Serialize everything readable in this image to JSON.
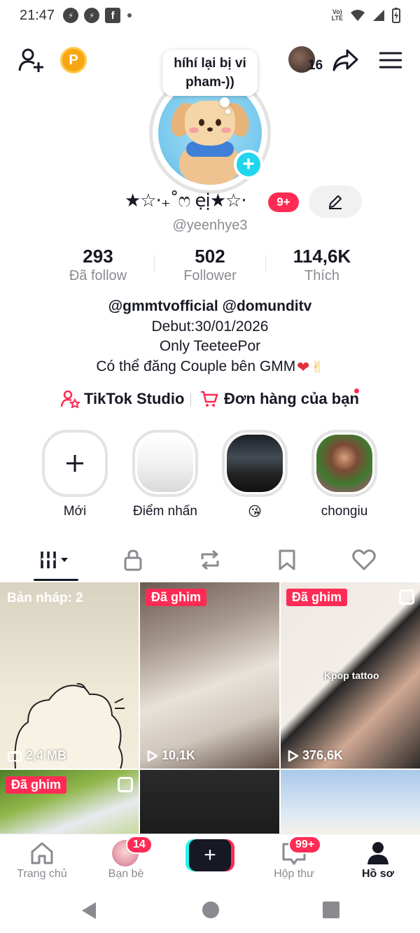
{
  "status_bar": {
    "time": "21:47",
    "volte": "VoLTE"
  },
  "bubble": {
    "line1": "híhí lại bị vi",
    "line2": "pham-))"
  },
  "top_bar": {
    "following_count": "16",
    "coin_letter": "P"
  },
  "profile": {
    "display_name": "★☆·₊˚ෆ ẹị★☆·",
    "name_badge": "9+",
    "username": "@yeenhye3"
  },
  "stats": [
    {
      "value": "293",
      "label": "Đã follow"
    },
    {
      "value": "502",
      "label": "Follower"
    },
    {
      "value": "114,6K",
      "label": "Thích"
    }
  ],
  "bio": {
    "mentions": "@gmmtvofficial @domunditv",
    "line2": "Debut:30/01/2026",
    "line3": "Only TeeteePor",
    "line4": "Có thể đăng Couple bên GMM"
  },
  "links": {
    "studio": "TikTok Studio",
    "orders": "Đơn hàng của bạn"
  },
  "highlights": [
    {
      "label": "Mới"
    },
    {
      "label": "Điểm nhấn"
    },
    {
      "label": "😘"
    },
    {
      "label": "chongiu"
    }
  ],
  "grid": {
    "draft_label": "Bản nháp: 2",
    "draft_size": "2,4 MB",
    "pinned_label": "Đã ghim",
    "video2_views": "10,1K",
    "video3_views": "376,6K",
    "video3_caption": "Kpop tattoo"
  },
  "bottom_nav": {
    "home": "Trang chủ",
    "friends": "Bạn bè",
    "friends_badge": "14",
    "inbox": "Hộp thư",
    "inbox_badge": "99+",
    "profile": "Hồ sơ"
  },
  "colors": {
    "accent": "#fe2c55",
    "cyan": "#20d5ec",
    "text": "#161823",
    "muted": "#8a8b91"
  }
}
